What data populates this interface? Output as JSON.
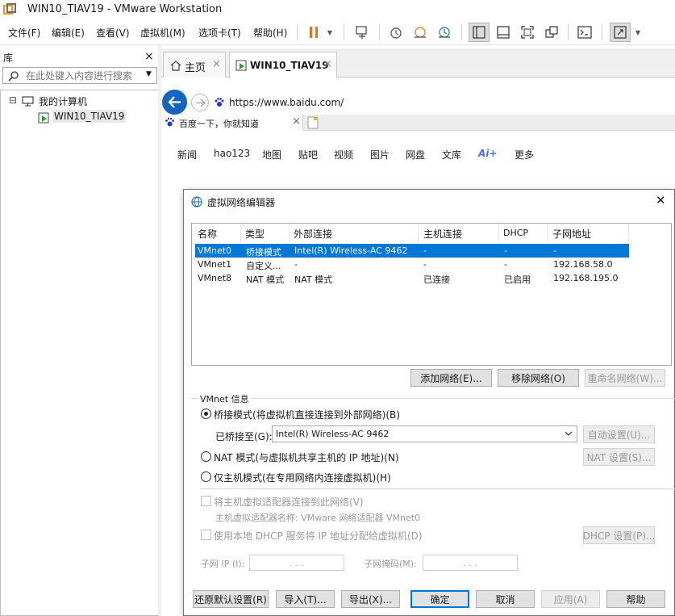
{
  "window": {
    "title": "WIN10_TIAV19 - VMware Workstation"
  },
  "menu": [
    "文件(F)",
    "编辑(E)",
    "查看(V)",
    "虚拟机(M)",
    "选项卡(T)",
    "帮助(H)"
  ],
  "library": {
    "title": "库",
    "close": "×",
    "search_placeholder": "在此处键入内容进行搜索",
    "tree": {
      "root": "我的计算机",
      "vm": "WIN10_TIAV19",
      "expander": "⊟"
    }
  },
  "tabs": [
    {
      "label": "主页",
      "close": "×"
    },
    {
      "label": "WIN10_TIAV19",
      "close": "×"
    }
  ],
  "browser": {
    "url": "https://www.baidu.com/",
    "tab_title": "百度一下，你就知道",
    "tab_close": "×",
    "links": [
      "新闻",
      "hao123",
      "地图",
      "贴吧",
      "视频",
      "图片",
      "网盘",
      "文库",
      "Ai+",
      "更多"
    ]
  },
  "dialog": {
    "title": "虚拟网络编辑器",
    "close": "✕",
    "columns": [
      "名称",
      "类型",
      "外部连接",
      "主机连接",
      "DHCP",
      "子网地址"
    ],
    "rows": [
      {
        "name": "VMnet0",
        "type": "桥接模式",
        "external": "Intel(R) Wireless-AC 9462",
        "host": "-",
        "dhcp": "-",
        "subnet": "-"
      },
      {
        "name": "VMnet1",
        "type": "自定义...",
        "external": "-",
        "host": "-",
        "dhcp": "-",
        "subnet": "192.168.58.0"
      },
      {
        "name": "VMnet8",
        "type": "NAT 模式",
        "external": "NAT 模式",
        "host": "已连接",
        "dhcp": "已启用",
        "subnet": "192.168.195.0"
      }
    ],
    "add_network": "添加网络(E)...",
    "remove_network": "移除网络(O)",
    "rename_network": "重命名网络(W)...",
    "vmnet_info": "VMnet 信息",
    "bridge_mode": "桥接模式(将虚拟机直接连接到外部网络)(B)",
    "bridged_to_label": "已桥接至(G):",
    "bridged_to_value": "Intel(R) Wireless-AC 9462",
    "auto_settings": "自动设置(U)...",
    "nat_mode": "NAT 模式(与虚拟机共享主机的 IP 地址)(N)",
    "nat_settings": "NAT 设置(S)...",
    "host_only": "仅主机模式(在专用网络内连接虚拟机)(H)",
    "connect_host_adapter": "将主机虚拟适配器连接到此网络(V)",
    "host_adapter_name": "主机虚拟适配器名称: VMware 网络适配器 VMnet0",
    "use_dhcp": "使用本地 DHCP 服务将 IP 地址分配给虚拟机(D)",
    "dhcp_settings": "DHCP 设置(P)...",
    "subnet_ip_label": "子网 IP (I):",
    "subnet_mask_label": "子网掩码(M):",
    "ip_dots": ".   .   .",
    "restore_defaults": "还原默认设置(R)",
    "import": "导入(T)...",
    "export": "导出(X)...",
    "ok": "确定",
    "cancel": "取消",
    "apply": "应用(A)",
    "help": "帮助"
  },
  "colors": {
    "accent": "#0078d7",
    "pause": "#e8741a",
    "back": "#1565c0",
    "baidu": "#2932e1"
  }
}
